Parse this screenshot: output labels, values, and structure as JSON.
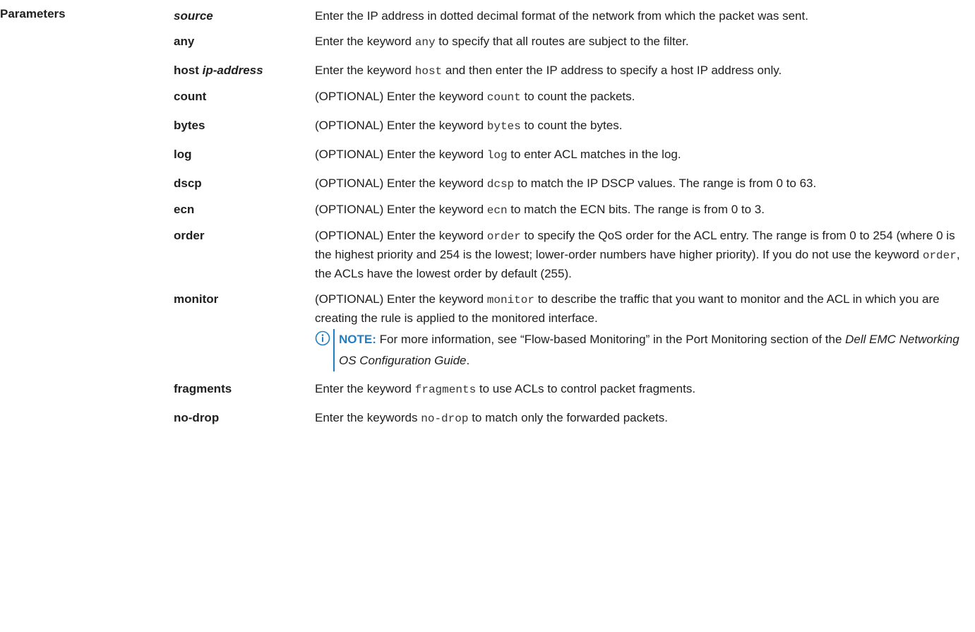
{
  "section_label": "Parameters",
  "params": [
    {
      "term": "source",
      "parts": [
        "Enter the IP address in dotted decimal format of the network from which the packet was sent."
      ]
    },
    {
      "term": "any",
      "parts": [
        "Enter the keyword ",
        "any",
        " to specify that all routes are subject to the filter."
      ]
    },
    {
      "term": "host",
      "term_arg": "ip-address",
      "parts": [
        "Enter the keyword ",
        "host",
        " and then enter the IP address to specify a host IP address only."
      ]
    },
    {
      "term": "count",
      "parts": [
        "(OPTIONAL) Enter the keyword ",
        "count",
        " to count the packets."
      ]
    },
    {
      "term": "bytes",
      "parts": [
        "(OPTIONAL) Enter the keyword ",
        "bytes",
        " to count the bytes."
      ]
    },
    {
      "term": "log",
      "parts": [
        "(OPTIONAL) Enter the keyword ",
        "log",
        " to enter ACL matches in the log."
      ]
    },
    {
      "term": "dscp",
      "parts": [
        "(OPTIONAL) Enter the keyword ",
        "dcsp",
        " to match the IP DSCP values. The range is from 0 to 63."
      ]
    },
    {
      "term": "ecn",
      "parts": [
        "(OPTIONAL) Enter the keyword ",
        "ecn",
        " to match the ECN bits. The range is from 0 to 3."
      ]
    },
    {
      "term": "order",
      "parts": [
        "(OPTIONAL) Enter the keyword ",
        "order",
        " to specify the QoS order for the ACL entry. The range is from 0 to 254 (where 0 is the highest priority and 254 is the lowest; lower-order numbers have higher priority). If you do not use the keyword ",
        "order",
        ", the ACLs have the lowest order by default (255)."
      ]
    },
    {
      "term": "monitor",
      "parts": [
        "(OPTIONAL) Enter the keyword ",
        "monitor",
        " to describe the traffic that you want to monitor and the ACL in which you are creating the rule is applied to the monitored interface."
      ],
      "note": {
        "label": "NOTE:",
        "text_before": " For more information, see “Flow-based Monitoring” in the Port Monitoring section of the ",
        "doc_title": "Dell EMC Networking OS Configuration Guide",
        "text_after": "."
      }
    },
    {
      "term": "fragments",
      "parts": [
        "Enter the keyword ",
        "fragments",
        " to use ACLs to control packet fragments."
      ]
    },
    {
      "term": "no-drop",
      "parts": [
        "Enter the keywords ",
        "no-drop",
        " to match only the forwarded packets."
      ]
    }
  ],
  "colors": {
    "note_accent": "#1f7fc4",
    "text": "#202020"
  },
  "icons": {
    "note": "info-circle-icon"
  }
}
